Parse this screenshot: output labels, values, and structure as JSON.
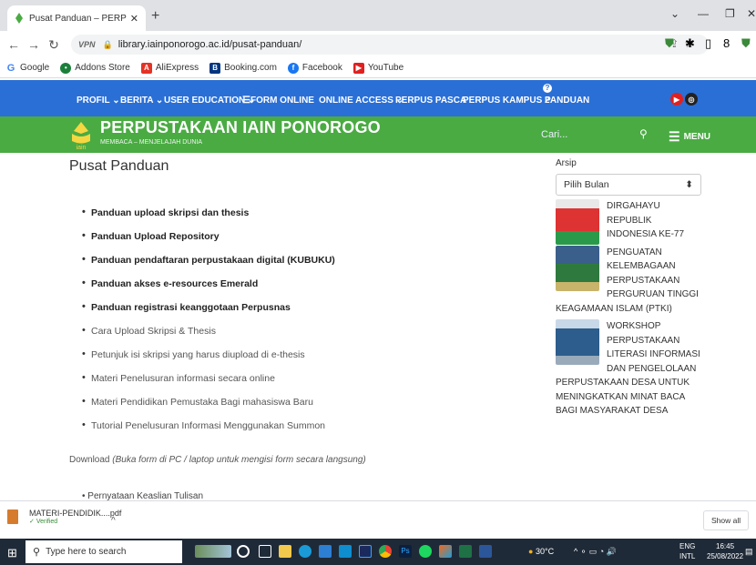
{
  "browser": {
    "tab_title": "Pusat Panduan – PERPUSTAKAAN IAIN PONOROGO",
    "url": "library.iainponorogo.ac.id/pusat-panduan/",
    "vpn_label": "VPN",
    "bookmarks": [
      "Google",
      "Addons Store",
      "AliExpress",
      "Booking.com",
      "Facebook",
      "YouTube"
    ]
  },
  "site_nav": {
    "items": [
      "PROFIL",
      "BERITA",
      "USER EDUCATION",
      "FORM ONLINE",
      "ONLINE ACCESS",
      "PERPUS PASCA",
      "PERPUS KAMPUS 2",
      "PANDUAN"
    ],
    "badge": "?"
  },
  "header": {
    "brand": "PERPUSTAKAAN IAIN PONOROGO",
    "tagline": "MEMBACA – MENJELAJAH DUNIA",
    "search_placeholder": "Cari...",
    "menu_label": "MENU",
    "logo_text": "iain"
  },
  "main": {
    "title": "Pusat Panduan",
    "items_bold": [
      "Panduan upload skripsi dan thesis",
      "Panduan Upload Repository",
      "Panduan pendaftaran perpustakaan digital (KUBUKU)",
      "Panduan akses e-resources Emerald",
      "Panduan registrasi keanggotaan Perpusnas"
    ],
    "items_light": [
      "Cara Upload Skripsi & Thesis",
      "Petunjuk isi skripsi yang harus diupload di e-thesis",
      "Materi Penelusuran informasi secara online",
      "Materi Pendidikan Pemustaka Bagi mahasiswa Baru",
      "Tutorial Penelusuran Informasi Menggunakan Summon"
    ],
    "download_label": "Download",
    "download_note": "(Buka form di PC / laptop untuk mengisi form secara langsung)",
    "cut_item": "Pernyataan Keaslian Tulisan"
  },
  "sidebar": {
    "arsip_label": "Arsip",
    "select_value": "Pilih Bulan",
    "posts": [
      "DIRGAHAYU REPUBLIK INDONESIA KE-77",
      "PENGUATAN KELEMBAGAAN PERPUSTAKAAN PERGURUAN TINGGI KEAGAMAAN ISLAM (PTKI)",
      "WORKSHOP PERPUSTAKAAN LITERASI INFORMASI DAN PENGELOLAAN PERPUSTAKAAN DESA UNTUK MENINGKATKAN MINAT BACA BAGI MASYARAKAT DESA"
    ]
  },
  "download_bar": {
    "file_name": "MATERI-PENDIDIK....pdf",
    "status": "Verified",
    "show_all": "Show all"
  },
  "taskbar": {
    "search_placeholder": "Type here to search",
    "weather": "30°C",
    "lang_top": "ENG",
    "lang_bottom": "INTL",
    "time": "16:45",
    "date": "25/08/2022"
  }
}
